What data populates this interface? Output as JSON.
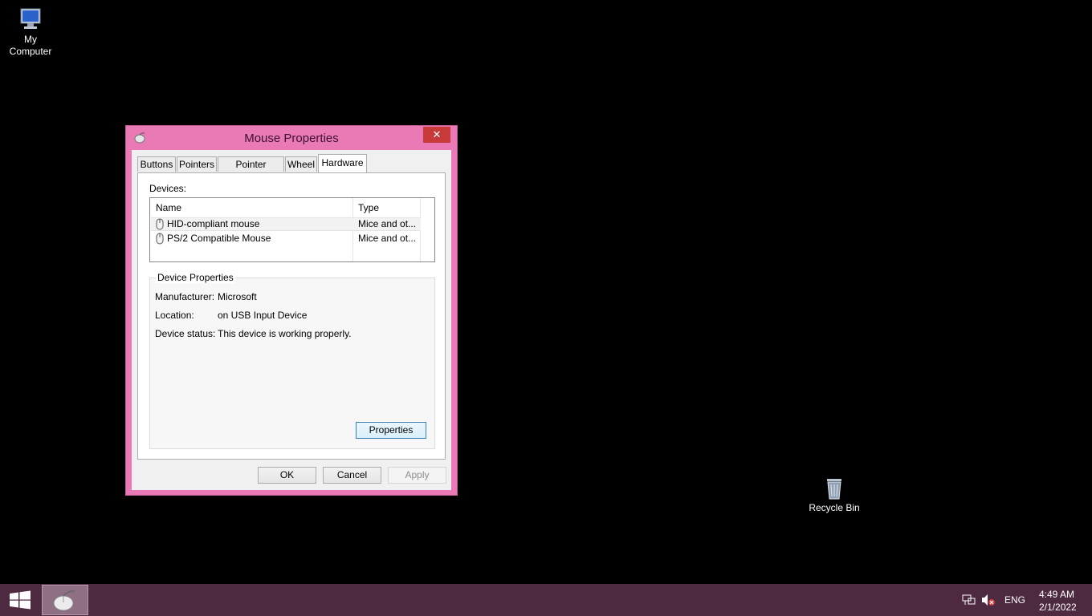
{
  "desktop": {
    "my_computer_line1": "My",
    "my_computer_line2": "Computer",
    "recycle_bin": "Recycle Bin"
  },
  "window": {
    "title": "Mouse Properties",
    "close_glyph": "✕",
    "tabs": [
      "Buttons",
      "Pointers",
      "Pointer Options",
      "Wheel",
      "Hardware"
    ],
    "active_tab": "Hardware",
    "devices_label": "Devices:",
    "columns": {
      "name": "Name",
      "type": "Type"
    },
    "devices": [
      {
        "name": "HID-compliant mouse",
        "type": "Mice and ot..."
      },
      {
        "name": "PS/2 Compatible Mouse",
        "type": "Mice and ot..."
      }
    ],
    "group_title": "Device Properties",
    "properties": {
      "manufacturer_label": "Manufacturer:",
      "manufacturer_value": "Microsoft",
      "location_label": "Location:",
      "location_value": "on USB Input Device",
      "status_label": "Device status:",
      "status_value": "This device is working properly."
    },
    "properties_button": "Properties",
    "ok_button": "OK",
    "cancel_button": "Cancel",
    "apply_button": "Apply"
  },
  "taskbar": {
    "language": "ENG",
    "time": "4:49 AM",
    "date": "2/1/2022"
  },
  "colors": {
    "window_frame": "#e97ab5",
    "taskbar": "#4e2a40",
    "close_button": "#c73a3a"
  }
}
